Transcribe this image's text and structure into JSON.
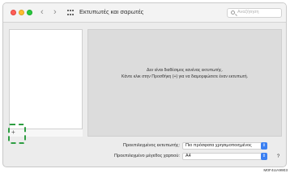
{
  "window": {
    "title": "Εκτυπωτές και σαρωτές",
    "nav_back": "‹",
    "nav_forward": "›",
    "search_placeholder": "Αναζήτηση"
  },
  "sidebar": {
    "add_button": "+"
  },
  "main": {
    "message_line1": "Δεν είναι διαθέσιμος κανένας εκτυπωτής.",
    "message_line2": "Κάντε κλικ στην Προσθήκη (+) για να διαμορφώσετε έναν εκτυπωτή."
  },
  "settings": {
    "default_printer_label": "Προεπιλεγμένος εκτυπωτής:",
    "default_printer_value": "Πιο πρόσφατα χρησιμοποιημένος",
    "paper_size_label": "Προεπιλεγμένο μέγεθος χαρτιού:",
    "paper_size_value": "A4",
    "help": "?"
  },
  "caption": "M0F4UA9903",
  "colors": {
    "highlight": "#2e9e42",
    "accent": "#3b80f2"
  }
}
